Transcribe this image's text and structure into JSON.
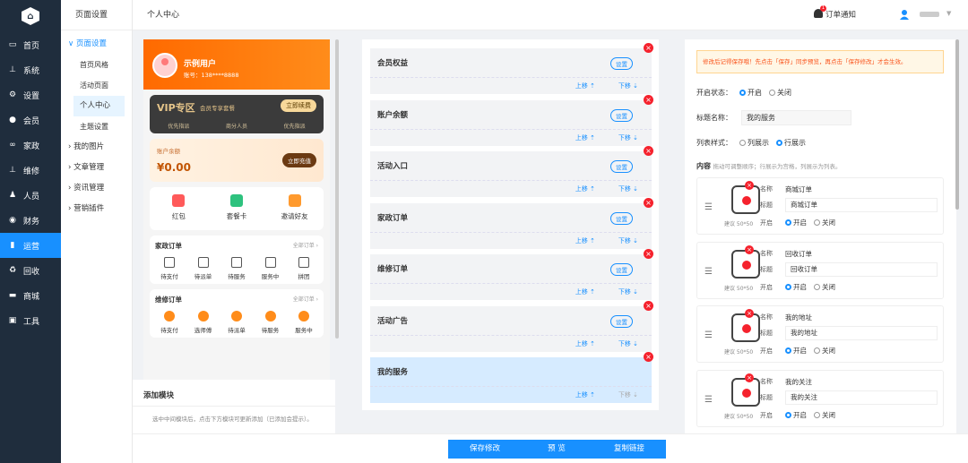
{
  "sidebar": {
    "items": [
      {
        "label": "首页",
        "icon": "monitor-icon"
      },
      {
        "label": "系统",
        "icon": "sitemap-icon"
      },
      {
        "label": "设置",
        "icon": "gear-icon"
      },
      {
        "label": "会员",
        "icon": "user-icon"
      },
      {
        "label": "家政",
        "icon": "link-icon"
      },
      {
        "label": "维修",
        "icon": "sitemap-icon"
      },
      {
        "label": "人员",
        "icon": "person-icon"
      },
      {
        "label": "财务",
        "icon": "coin-icon"
      },
      {
        "label": "运营",
        "icon": "chart-icon"
      },
      {
        "label": "回收",
        "icon": "recycle-icon"
      },
      {
        "label": "商城",
        "icon": "shop-icon"
      },
      {
        "label": "工具",
        "icon": "toolbox-icon"
      }
    ],
    "active_index": 8
  },
  "submenu": {
    "header": "页面设置",
    "items": [
      {
        "label": "页面设置",
        "type": "open"
      },
      {
        "label": "首页风格",
        "type": "child"
      },
      {
        "label": "活动页面",
        "type": "child"
      },
      {
        "label": "个人中心",
        "type": "sel"
      },
      {
        "label": "主题设置",
        "type": "child"
      },
      {
        "label": "我的图片",
        "type": "group"
      },
      {
        "label": "文章管理",
        "type": "group"
      },
      {
        "label": "资讯管理",
        "type": "group"
      },
      {
        "label": "营销插件",
        "type": "group"
      }
    ]
  },
  "topbar": {
    "title": "个人中心",
    "notice_label": "订单通知",
    "notice_count": "1"
  },
  "preview": {
    "user_name": "示例用户",
    "user_phone": "账号：138****8888",
    "vip_title": "VIP专区",
    "vip_sub": "会员专享套餐",
    "vip_btn": "立即续费",
    "vip_perks": [
      "优先指派",
      "商分人员",
      "优先指派"
    ],
    "balance_label": "账户余额",
    "balance_value": "¥0.00",
    "balance_btn": "立即充值",
    "quick": [
      {
        "label": "红包",
        "color": "#ff5a5a"
      },
      {
        "label": "套餐卡",
        "color": "#2ec27e"
      },
      {
        "label": "邀请好友",
        "color": "#ff9a2e"
      }
    ],
    "home_order": {
      "title": "家政订单",
      "more": "全部订单 ›",
      "items": [
        "待支付",
        "待派单",
        "待服务",
        "服务中",
        "拼团"
      ]
    },
    "repair_order": {
      "title": "维修订单",
      "more": "全部订单 ›",
      "items": [
        "待支付",
        "选师傅",
        "待派单",
        "待服务",
        "服务中"
      ]
    }
  },
  "add_module": {
    "title": "添加模块",
    "desc": "选中中间模块后，点击下方模块可更新添加（已添加会提示）。"
  },
  "modules": [
    {
      "name": "会员权益",
      "up": "上移",
      "down": "下移",
      "set": "设置"
    },
    {
      "name": "账户余额",
      "up": "上移",
      "down": "下移",
      "set": "设置"
    },
    {
      "name": "活动入口",
      "up": "上移",
      "down": "下移",
      "set": "设置"
    },
    {
      "name": "家政订单",
      "up": "上移",
      "down": "下移",
      "set": "设置"
    },
    {
      "name": "维修订单",
      "up": "上移",
      "down": "下移",
      "set": "设置"
    },
    {
      "name": "活动广告",
      "up": "上移",
      "down": "下移",
      "set": "设置"
    },
    {
      "name": "我的服务",
      "up": "上移",
      "down": "下移",
      "set": ""
    }
  ],
  "settings": {
    "warning": "修改后记得保存哦！先点击「保存」同步预览，再点击「保存修改」才会生效。",
    "status_label": "开启状态：",
    "status_on": "开启",
    "status_off": "关闭",
    "title_label": "标题名称：",
    "title_value": "我的服务",
    "style_label": "列表样式：",
    "style_a": "列展示",
    "style_b": "行展示",
    "content_label": "内容",
    "content_hint": "拖动可调整顺序；行展示为宫格，列展示为列表。",
    "services": [
      {
        "name": "商城订单",
        "title": "商城订单"
      },
      {
        "name": "回收订单",
        "title": "回收订单"
      },
      {
        "name": "我的地址",
        "title": "我的地址"
      },
      {
        "name": "我的关注",
        "title": "我的关注"
      }
    ],
    "k_name": "名称",
    "k_title": "标题",
    "k_open": "开启",
    "open": "开启",
    "close": "关闭",
    "img_tip": "建议 50*50"
  },
  "footer": {
    "save": "保存修改",
    "preview": "预 览",
    "copy": "复制链接"
  }
}
